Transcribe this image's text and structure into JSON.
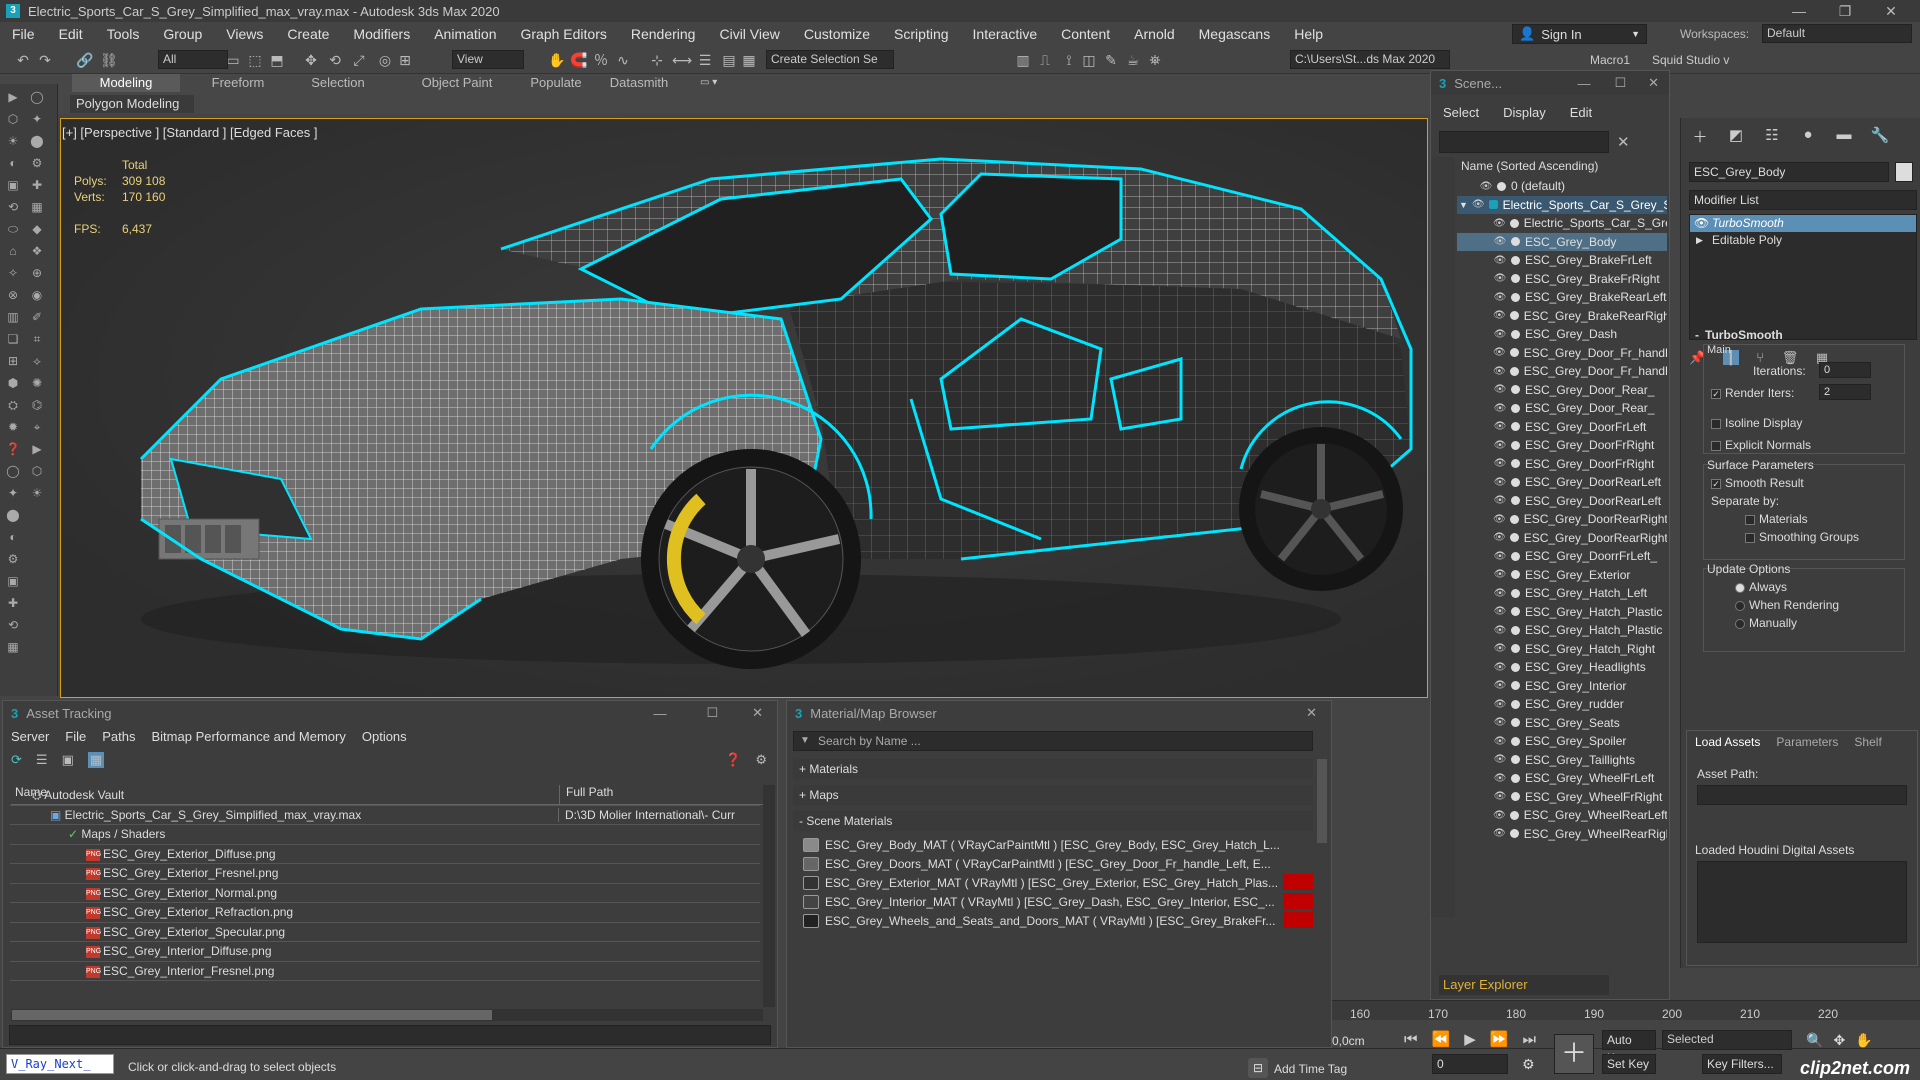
{
  "app": {
    "title": "Electric_Sports_Car_S_Grey_Simplified_max_vray.max - Autodesk 3ds Max 2020",
    "icon_letter": "3"
  },
  "menu": [
    "File",
    "Edit",
    "Tools",
    "Group",
    "Views",
    "Create",
    "Modifiers",
    "Animation",
    "Graph Editors",
    "Rendering",
    "Civil View",
    "Customize",
    "Scripting",
    "Interactive",
    "Content",
    "Arnold",
    "Megascans",
    "Help"
  ],
  "signin": {
    "label": "Sign In"
  },
  "workspaces": {
    "label": "Workspaces:",
    "value": "Default"
  },
  "toolbar": {
    "filter_value": "All",
    "refcoord_value": "View",
    "selection_set_placeholder": "Create Selection Se",
    "path_value": "C:\\Users\\St...ds Max 2020",
    "macro_label": "Macro1",
    "squid_label": "Squid Studio v"
  },
  "ribbon": {
    "tabs": [
      "Modeling",
      "Freeform",
      "Selection",
      "Object Paint",
      "Populate",
      "Datasmith"
    ],
    "subtab": "Polygon Modeling"
  },
  "viewport": {
    "label": "[+] [Perspective ] [Standard ] [Edged Faces ]",
    "stats_total": "Total",
    "polys_label": "Polys:",
    "polys_value": "309 108",
    "verts_label": "Verts:",
    "verts_value": "170 160",
    "fps_label": "FPS:",
    "fps_value": "6,437"
  },
  "scene_explorer": {
    "title": "Scene...",
    "menu": [
      "Select",
      "Display",
      "Edit"
    ],
    "column": "Name (Sorted Ascending)",
    "rows": [
      {
        "label": "0 (default)",
        "indent": 0,
        "sel": false
      },
      {
        "label": "Electric_Sports_Car_S_Grey_Simplified",
        "indent": 0,
        "sel": false,
        "root": true
      },
      {
        "label": "Electric_Sports_Car_S_Grey",
        "indent": 1,
        "sel": false
      },
      {
        "label": "ESC_Grey_Body",
        "indent": 2,
        "sel": true
      },
      {
        "label": "ESC_Grey_BrakeFrLeft",
        "indent": 2,
        "sel": false
      },
      {
        "label": "ESC_Grey_BrakeFrRight",
        "indent": 2,
        "sel": false
      },
      {
        "label": "ESC_Grey_BrakeRearLeft",
        "indent": 2,
        "sel": false
      },
      {
        "label": "ESC_Grey_BrakeRearRight",
        "indent": 2,
        "sel": false
      },
      {
        "label": "ESC_Grey_Dash",
        "indent": 2,
        "sel": false
      },
      {
        "label": "ESC_Grey_Door_Fr_handle",
        "indent": 2,
        "sel": false
      },
      {
        "label": "ESC_Grey_Door_Fr_handle",
        "indent": 2,
        "sel": false
      },
      {
        "label": "ESC_Grey_Door_Rear_",
        "indent": 2,
        "sel": false
      },
      {
        "label": "ESC_Grey_Door_Rear_",
        "indent": 2,
        "sel": false
      },
      {
        "label": "ESC_Grey_DoorFrLeft",
        "indent": 2,
        "sel": false
      },
      {
        "label": "ESC_Grey_DoorFrRight",
        "indent": 2,
        "sel": false
      },
      {
        "label": "ESC_Grey_DoorFrRight",
        "indent": 2,
        "sel": false
      },
      {
        "label": "ESC_Grey_DoorRearLeft",
        "indent": 2,
        "sel": false
      },
      {
        "label": "ESC_Grey_DoorRearLeft",
        "indent": 2,
        "sel": false
      },
      {
        "label": "ESC_Grey_DoorRearRight",
        "indent": 2,
        "sel": false
      },
      {
        "label": "ESC_Grey_DoorRearRight",
        "indent": 2,
        "sel": false
      },
      {
        "label": "ESC_Grey_DoorrFrLeft_",
        "indent": 2,
        "sel": false
      },
      {
        "label": "ESC_Grey_Exterior",
        "indent": 2,
        "sel": false
      },
      {
        "label": "ESC_Grey_Hatch_Left",
        "indent": 2,
        "sel": false
      },
      {
        "label": "ESC_Grey_Hatch_Plastic",
        "indent": 2,
        "sel": false
      },
      {
        "label": "ESC_Grey_Hatch_Plastic",
        "indent": 2,
        "sel": false
      },
      {
        "label": "ESC_Grey_Hatch_Right",
        "indent": 2,
        "sel": false
      },
      {
        "label": "ESC_Grey_Headlights",
        "indent": 2,
        "sel": false
      },
      {
        "label": "ESC_Grey_Interior",
        "indent": 2,
        "sel": false
      },
      {
        "label": "ESC_Grey_rudder",
        "indent": 2,
        "sel": false
      },
      {
        "label": "ESC_Grey_Seats",
        "indent": 2,
        "sel": false
      },
      {
        "label": "ESC_Grey_Spoiler",
        "indent": 2,
        "sel": false
      },
      {
        "label": "ESC_Grey_Taillights",
        "indent": 2,
        "sel": false
      },
      {
        "label": "ESC_Grey_WheelFrLeft",
        "indent": 2,
        "sel": false
      },
      {
        "label": "ESC_Grey_WheelFrRight",
        "indent": 2,
        "sel": false
      },
      {
        "label": "ESC_Grey_WheelRearLeft",
        "indent": 2,
        "sel": false
      },
      {
        "label": "ESC_Grey_WheelRearRight",
        "indent": 2,
        "sel": false
      }
    ],
    "layer_explorer": "Layer Explorer"
  },
  "command_panel": {
    "object_name": "ESC_Grey_Body",
    "modifier_list": "Modifier List",
    "stack": [
      "TurboSmooth",
      "Editable Poly"
    ],
    "rollout_title": "TurboSmooth",
    "main": "Main",
    "iterations_label": "Iterations:",
    "iterations_value": "0",
    "render_iters_label": "Render Iters:",
    "render_iters_value": "2",
    "isoline": "Isoline Display",
    "explicit": "Explicit Normals",
    "surface": "Surface Parameters",
    "smooth": "Smooth Result",
    "separate": "Separate by:",
    "materials": "Materials",
    "smoothing": "Smoothing Groups",
    "update": "Update Options",
    "always": "Always",
    "when_render": "When Rendering",
    "manually": "Manually"
  },
  "houdini": {
    "tabs": [
      "Load Assets",
      "Parameters",
      "Shelf"
    ],
    "asset_path": "Asset Path:",
    "loaded": "Loaded Houdini Digital Assets"
  },
  "asset_tracking": {
    "title": "Asset Tracking",
    "menu": [
      "Server",
      "File",
      "Paths",
      "Bitmap Performance and Memory",
      "Options"
    ],
    "col_name": "Name",
    "col_path": "Full Path",
    "rows": [
      {
        "name": "Autodesk Vault",
        "path": "",
        "indent": 1,
        "kind": "vault"
      },
      {
        "name": "Electric_Sports_Car_S_Grey_Simplified_max_vray.max",
        "path": "D:\\3D Molier International\\- Curr",
        "indent": 2,
        "kind": "max"
      },
      {
        "name": "Maps / Shaders",
        "path": "",
        "indent": 3,
        "kind": "maps"
      },
      {
        "name": "ESC_Grey_Exterior_Diffuse.png",
        "path": "",
        "indent": 4,
        "kind": "png"
      },
      {
        "name": "ESC_Grey_Exterior_Fresnel.png",
        "path": "",
        "indent": 4,
        "kind": "png"
      },
      {
        "name": "ESC_Grey_Exterior_Normal.png",
        "path": "",
        "indent": 4,
        "kind": "png"
      },
      {
        "name": "ESC_Grey_Exterior_Refraction.png",
        "path": "",
        "indent": 4,
        "kind": "png"
      },
      {
        "name": "ESC_Grey_Exterior_Specular.png",
        "path": "",
        "indent": 4,
        "kind": "png"
      },
      {
        "name": "ESC_Grey_Interior_Diffuse.png",
        "path": "",
        "indent": 4,
        "kind": "png"
      },
      {
        "name": "ESC_Grey_Interior_Fresnel.png",
        "path": "",
        "indent": 4,
        "kind": "png"
      }
    ]
  },
  "material_browser": {
    "title": "Material/Map Browser",
    "search_placeholder": "Search by Name ...",
    "materials": "+ Materials",
    "maps": "+ Maps",
    "scene_materials": "- Scene Materials",
    "rows": [
      {
        "label": "ESC_Grey_Body_MAT  ( VRayCarPaintMtl )  [ESC_Grey_Body, ESC_Grey_Hatch_L...",
        "red": false,
        "swatch": "#8a8a8a"
      },
      {
        "label": "ESC_Grey_Doors_MAT  ( VRayCarPaintMtl )  [ESC_Grey_Door_Fr_handle_Left, E...",
        "red": false,
        "swatch": "#666"
      },
      {
        "label": "ESC_Grey_Exterior_MAT  ( VRayMtl )  [ESC_Grey_Exterior, ESC_Grey_Hatch_Plas...",
        "red": true,
        "swatch": "#333"
      },
      {
        "label": "ESC_Grey_Interior_MAT  ( VRayMtl )  [ESC_Grey_Dash, ESC_Grey_Interior, ESC_...",
        "red": true,
        "swatch": "#444"
      },
      {
        "label": "ESC_Grey_Wheels_and_Seats_and_Doors_MAT  ( VRayMtl )  [ESC_Grey_BrakeFr...",
        "red": true,
        "swatch": "#222"
      }
    ]
  },
  "timeline": {
    "ticks": [
      "160",
      "170",
      "180",
      "190",
      "200",
      "210",
      "220"
    ]
  },
  "status": {
    "vray_label": "V_Ray_Next_",
    "message": "Click or click-and-drag to select objects",
    "add_time_tag": "Add Time Tag",
    "unit": "0,0cm",
    "frame": "0",
    "auto_key": "Auto Key",
    "set_key": "Set Key",
    "selected": "Selected",
    "key_filters": "Key Filters...",
    "watermark": "clip2net.com"
  },
  "colors": {
    "accent": "#d4a017",
    "wire": "#00e5ff",
    "selection": "#4f6f86"
  }
}
